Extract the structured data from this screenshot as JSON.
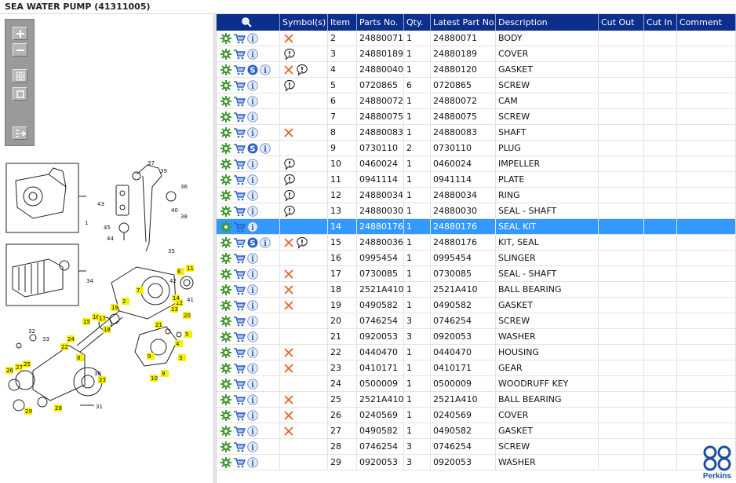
{
  "window": {
    "title": "SEA WATER PUMP (41311005)"
  },
  "colors": {
    "header_bg": "#0d2f8c",
    "selected_row": "#3399ff",
    "cross": "#e8612c",
    "gear": "#3d9b2f",
    "cart": "#2c62c8",
    "logo": "#1c4f9e"
  },
  "toolbar": {
    "buttons": [
      "zoom-in-icon",
      "zoom-out-icon",
      "fit-page-icon",
      "actual-size-icon",
      "panel-toggle-icon"
    ]
  },
  "drawing": {
    "callouts": [
      "37",
      "39",
      "36",
      "43",
      "38",
      "40",
      "45",
      "44",
      "1",
      "35",
      "34",
      "6",
      "11",
      "42",
      "41",
      "12",
      "13",
      "14",
      "7",
      "2",
      "19",
      "15",
      "16",
      "17",
      "18",
      "20",
      "21",
      "5",
      "3",
      "4",
      "32",
      "33",
      "24",
      "22",
      "8",
      "31",
      "23",
      "30",
      "26",
      "27",
      "25",
      "28",
      "29",
      "9",
      "10",
      "9"
    ]
  },
  "grid": {
    "columns": [
      "",
      "Symbol(s)",
      "Item",
      "Parts No.",
      "Qty.",
      "Latest Part No.",
      "Description",
      "Cut Out",
      "Cut In",
      "Comment"
    ],
    "header_icon": "search-icon",
    "rows": [
      {
        "item": "2",
        "part": "24880071",
        "qty": "1",
        "latest": "24880071",
        "desc": "BODY",
        "s": false,
        "cross": true,
        "balloon": false,
        "selected": false
      },
      {
        "item": "3",
        "part": "24880189",
        "qty": "1",
        "latest": "24880189",
        "desc": "COVER",
        "s": false,
        "cross": false,
        "balloon": true,
        "selected": false
      },
      {
        "item": "4",
        "part": "24880040",
        "qty": "1",
        "latest": "24880120",
        "desc": "GASKET",
        "s": true,
        "cross": true,
        "balloon": true,
        "selected": false
      },
      {
        "item": "5",
        "part": "0720865",
        "qty": "6",
        "latest": "0720865",
        "desc": "SCREW",
        "s": false,
        "cross": false,
        "balloon": true,
        "selected": false
      },
      {
        "item": "6",
        "part": "24880072",
        "qty": "1",
        "latest": "24880072",
        "desc": "CAM",
        "s": false,
        "cross": false,
        "balloon": false,
        "selected": false
      },
      {
        "item": "7",
        "part": "24880075",
        "qty": "1",
        "latest": "24880075",
        "desc": "SCREW",
        "s": false,
        "cross": false,
        "balloon": false,
        "selected": false
      },
      {
        "item": "8",
        "part": "24880083",
        "qty": "1",
        "latest": "24880083",
        "desc": "SHAFT",
        "s": false,
        "cross": true,
        "balloon": false,
        "selected": false
      },
      {
        "item": "9",
        "part": "0730110",
        "qty": "2",
        "latest": "0730110",
        "desc": "PLUG",
        "s": true,
        "cross": false,
        "balloon": false,
        "selected": false
      },
      {
        "item": "10",
        "part": "0460024",
        "qty": "1",
        "latest": "0460024",
        "desc": "IMPELLER",
        "s": false,
        "cross": false,
        "balloon": true,
        "selected": false
      },
      {
        "item": "11",
        "part": "0941114",
        "qty": "1",
        "latest": "0941114",
        "desc": "PLATE",
        "s": false,
        "cross": false,
        "balloon": true,
        "selected": false
      },
      {
        "item": "12",
        "part": "24880034",
        "qty": "1",
        "latest": "24880034",
        "desc": "RING",
        "s": false,
        "cross": false,
        "balloon": true,
        "selected": false
      },
      {
        "item": "13",
        "part": "24880030",
        "qty": "1",
        "latest": "24880030",
        "desc": "SEAL - SHAFT",
        "s": false,
        "cross": false,
        "balloon": true,
        "selected": false
      },
      {
        "item": "14",
        "part": "24880176",
        "qty": "1",
        "latest": "24880176",
        "desc": "SEAL KIT",
        "s": false,
        "cross": false,
        "balloon": false,
        "selected": true
      },
      {
        "item": "15",
        "part": "24880036",
        "qty": "1",
        "latest": "24880176",
        "desc": "KIT, SEAL",
        "s": true,
        "cross": true,
        "balloon": true,
        "selected": false
      },
      {
        "item": "16",
        "part": "0995454",
        "qty": "1",
        "latest": "0995454",
        "desc": "SLINGER",
        "s": false,
        "cross": false,
        "balloon": false,
        "selected": false
      },
      {
        "item": "17",
        "part": "0730085",
        "qty": "1",
        "latest": "0730085",
        "desc": "SEAL - SHAFT",
        "s": false,
        "cross": true,
        "balloon": false,
        "selected": false
      },
      {
        "item": "18",
        "part": "2521A410",
        "qty": "1",
        "latest": "2521A410",
        "desc": "BALL BEARING",
        "s": false,
        "cross": true,
        "balloon": false,
        "selected": false
      },
      {
        "item": "19",
        "part": "0490582",
        "qty": "1",
        "latest": "0490582",
        "desc": "GASKET",
        "s": false,
        "cross": true,
        "balloon": false,
        "selected": false
      },
      {
        "item": "20",
        "part": "0746254",
        "qty": "3",
        "latest": "0746254",
        "desc": "SCREW",
        "s": false,
        "cross": false,
        "balloon": false,
        "selected": false
      },
      {
        "item": "21",
        "part": "0920053",
        "qty": "3",
        "latest": "0920053",
        "desc": "WASHER",
        "s": false,
        "cross": false,
        "balloon": false,
        "selected": false
      },
      {
        "item": "22",
        "part": "0440470",
        "qty": "1",
        "latest": "0440470",
        "desc": "HOUSING",
        "s": false,
        "cross": true,
        "balloon": false,
        "selected": false
      },
      {
        "item": "23",
        "part": "0410171",
        "qty": "1",
        "latest": "0410171",
        "desc": "GEAR",
        "s": false,
        "cross": true,
        "balloon": false,
        "selected": false
      },
      {
        "item": "24",
        "part": "0500009",
        "qty": "1",
        "latest": "0500009",
        "desc": "WOODRUFF KEY",
        "s": false,
        "cross": false,
        "balloon": false,
        "selected": false
      },
      {
        "item": "25",
        "part": "2521A410",
        "qty": "1",
        "latest": "2521A410",
        "desc": "BALL BEARING",
        "s": false,
        "cross": true,
        "balloon": false,
        "selected": false
      },
      {
        "item": "26",
        "part": "0240569",
        "qty": "1",
        "latest": "0240569",
        "desc": "COVER",
        "s": false,
        "cross": true,
        "balloon": false,
        "selected": false
      },
      {
        "item": "27",
        "part": "0490582",
        "qty": "1",
        "latest": "0490582",
        "desc": "GASKET",
        "s": false,
        "cross": true,
        "balloon": false,
        "selected": false
      },
      {
        "item": "28",
        "part": "0746254",
        "qty": "3",
        "latest": "0746254",
        "desc": "SCREW",
        "s": false,
        "cross": false,
        "balloon": false,
        "selected": false
      },
      {
        "item": "29",
        "part": "0920053",
        "qty": "3",
        "latest": "0920053",
        "desc": "WASHER",
        "s": false,
        "cross": false,
        "balloon": false,
        "selected": false
      }
    ]
  },
  "logo": {
    "text": "Perkins"
  }
}
